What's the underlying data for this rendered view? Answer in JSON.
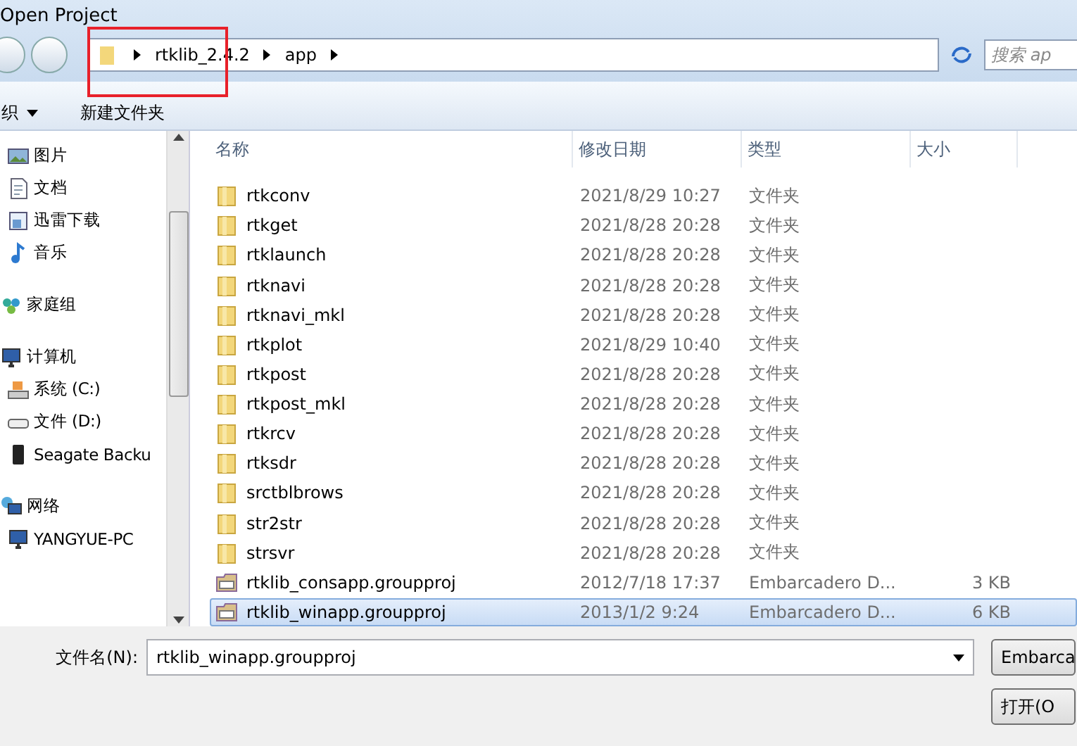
{
  "window": {
    "title": "Open Project"
  },
  "address": {
    "crumbs": [
      {
        "label": "rtklib_2.4.2",
        "highlighted": true
      },
      {
        "label": "app",
        "highlighted": false
      }
    ]
  },
  "search": {
    "placeholder": "搜索 ap"
  },
  "toolbar": {
    "organize": "织",
    "new_folder": "新建文件夹"
  },
  "sidebar": {
    "groups": [
      {
        "items": [
          {
            "label": "图片"
          },
          {
            "label": "文档"
          },
          {
            "label": "迅雷下载"
          },
          {
            "label": "音乐"
          }
        ]
      },
      {
        "label": "家庭组"
      },
      {
        "label": "计算机",
        "items": [
          {
            "label": "系统 (C:)"
          },
          {
            "label": "文件 (D:)"
          },
          {
            "label": "Seagate Backu"
          }
        ]
      },
      {
        "label": "网络",
        "items": [
          {
            "label": "YANGYUE-PC"
          }
        ]
      }
    ]
  },
  "table": {
    "columns": [
      "名称",
      "修改日期",
      "类型",
      "大小"
    ],
    "rows": [
      {
        "kind": "folder",
        "name": "rtkconv",
        "date": "2021/8/29 10:27",
        "type": "文件夹",
        "size": "",
        "selected": false
      },
      {
        "kind": "folder",
        "name": "rtkget",
        "date": "2021/8/28 20:28",
        "type": "文件夹",
        "size": "",
        "selected": false
      },
      {
        "kind": "folder",
        "name": "rtklaunch",
        "date": "2021/8/28 20:28",
        "type": "文件夹",
        "size": "",
        "selected": false
      },
      {
        "kind": "folder",
        "name": "rtknavi",
        "date": "2021/8/28 20:28",
        "type": "文件夹",
        "size": "",
        "selected": false
      },
      {
        "kind": "folder",
        "name": "rtknavi_mkl",
        "date": "2021/8/28 20:28",
        "type": "文件夹",
        "size": "",
        "selected": false
      },
      {
        "kind": "folder",
        "name": "rtkplot",
        "date": "2021/8/29 10:40",
        "type": "文件夹",
        "size": "",
        "selected": false
      },
      {
        "kind": "folder",
        "name": "rtkpost",
        "date": "2021/8/28 20:28",
        "type": "文件夹",
        "size": "",
        "selected": false
      },
      {
        "kind": "folder",
        "name": "rtkpost_mkl",
        "date": "2021/8/28 20:28",
        "type": "文件夹",
        "size": "",
        "selected": false
      },
      {
        "kind": "folder",
        "name": "rtkrcv",
        "date": "2021/8/28 20:28",
        "type": "文件夹",
        "size": "",
        "selected": false
      },
      {
        "kind": "folder",
        "name": "rtksdr",
        "date": "2021/8/28 20:28",
        "type": "文件夹",
        "size": "",
        "selected": false
      },
      {
        "kind": "folder",
        "name": "srctblbrows",
        "date": "2021/8/28 20:28",
        "type": "文件夹",
        "size": "",
        "selected": false
      },
      {
        "kind": "folder",
        "name": "str2str",
        "date": "2021/8/28 20:28",
        "type": "文件夹",
        "size": "",
        "selected": false
      },
      {
        "kind": "folder",
        "name": "strsvr",
        "date": "2021/8/28 20:28",
        "type": "文件夹",
        "size": "",
        "selected": false
      },
      {
        "kind": "project",
        "name": "rtklib_consapp.groupproj",
        "date": "2012/7/18 17:37",
        "type": "Embarcadero D...",
        "size": "3 KB",
        "selected": false
      },
      {
        "kind": "project",
        "name": "rtklib_winapp.groupproj",
        "date": "2013/1/2 9:24",
        "type": "Embarcadero D...",
        "size": "6 KB",
        "selected": true
      }
    ]
  },
  "footer": {
    "filename_label": "文件名(N):",
    "filename": "rtklib_winapp.groupproj",
    "filter": "Embarca",
    "open_button": "打开(O"
  }
}
